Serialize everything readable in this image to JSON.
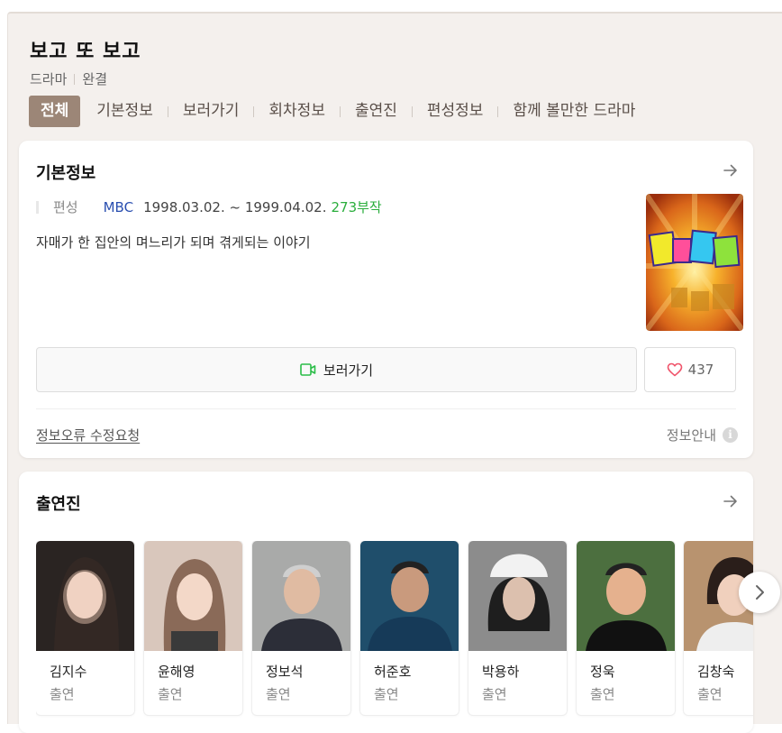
{
  "header": {
    "title": "보고 또 보고",
    "genre": "드라마",
    "status": "완결"
  },
  "tabs": [
    {
      "label": "전체",
      "active": true
    },
    {
      "label": "기본정보"
    },
    {
      "label": "보러가기"
    },
    {
      "label": "회차정보"
    },
    {
      "label": "출연진"
    },
    {
      "label": "편성정보"
    },
    {
      "label": "함께 볼만한 드라마"
    }
  ],
  "basic_info": {
    "section_title": "기본정보",
    "broadcast_label": "편성",
    "channel": "MBC",
    "dates": "1998.03.02. ~ 1999.04.02.",
    "episodes": "273부작",
    "synopsis": "자매가 한 집안의 며느리가 되며 겪게되는 이야기",
    "watch_label": "보러가기",
    "like_count": "437",
    "report_link": "정보오류 수정요청",
    "info_guide": "정보안내"
  },
  "cast": {
    "section_title": "출연진",
    "members": [
      {
        "name": "김지수",
        "role": "출연"
      },
      {
        "name": "윤해영",
        "role": "출연"
      },
      {
        "name": "정보석",
        "role": "출연"
      },
      {
        "name": "허준호",
        "role": "출연"
      },
      {
        "name": "박용하",
        "role": "출연"
      },
      {
        "name": "정욱",
        "role": "출연"
      },
      {
        "name": "김창숙",
        "role": "출연"
      }
    ]
  },
  "colors": {
    "accent_tab": "#9c8677",
    "channel_link": "#2a4fb0",
    "episodes_green": "#2bae3d",
    "page_bg": "#f4f0ed"
  }
}
